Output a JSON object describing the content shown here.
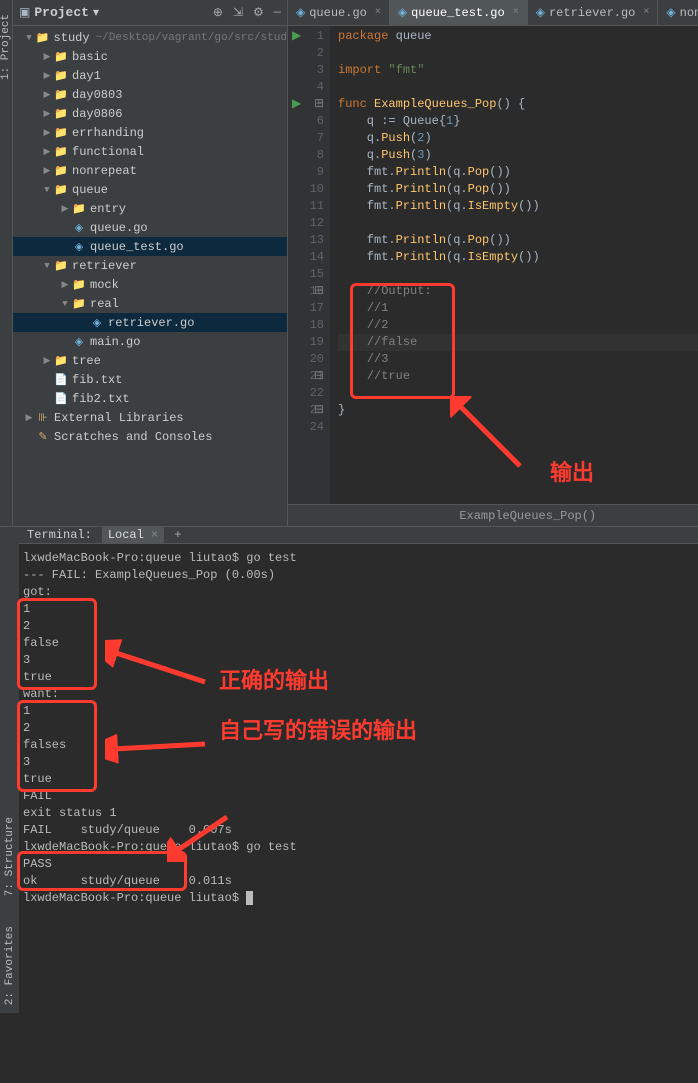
{
  "leftRail": {
    "projectLabel": "1: Project"
  },
  "sidebar": {
    "title": "Project",
    "icons": {
      "target": "⊕",
      "collapse": "⇲",
      "gear": "⚙",
      "hide": "—"
    },
    "tree": [
      {
        "lvl": 0,
        "tw": "▼",
        "ic": "📁",
        "cls": "fld",
        "nm": "study",
        "pth": "~/Desktop/vagrant/go/src/stud"
      },
      {
        "lvl": 1,
        "tw": "▶",
        "ic": "📁",
        "cls": "fld",
        "nm": "basic"
      },
      {
        "lvl": 1,
        "tw": "▶",
        "ic": "📁",
        "cls": "fld",
        "nm": "day1"
      },
      {
        "lvl": 1,
        "tw": "▶",
        "ic": "📁",
        "cls": "fld",
        "nm": "day0803"
      },
      {
        "lvl": 1,
        "tw": "▶",
        "ic": "📁",
        "cls": "fld",
        "nm": "day0806"
      },
      {
        "lvl": 1,
        "tw": "▶",
        "ic": "📁",
        "cls": "fld",
        "nm": "errhanding"
      },
      {
        "lvl": 1,
        "tw": "▶",
        "ic": "📁",
        "cls": "fld",
        "nm": "functional"
      },
      {
        "lvl": 1,
        "tw": "▶",
        "ic": "📁",
        "cls": "fld",
        "nm": "nonrepeat"
      },
      {
        "lvl": 1,
        "tw": "▼",
        "ic": "📁",
        "cls": "fld",
        "nm": "queue"
      },
      {
        "lvl": 2,
        "tw": "▶",
        "ic": "📁",
        "cls": "fld",
        "nm": "entry"
      },
      {
        "lvl": 2,
        "tw": "",
        "ic": "◈",
        "cls": "gof",
        "nm": "queue.go"
      },
      {
        "lvl": 2,
        "tw": "",
        "ic": "◈",
        "cls": "gof",
        "nm": "queue_test.go",
        "sel": true
      },
      {
        "lvl": 1,
        "tw": "▼",
        "ic": "📁",
        "cls": "fld",
        "nm": "retriever"
      },
      {
        "lvl": 2,
        "tw": "▶",
        "ic": "📁",
        "cls": "fld",
        "nm": "mock"
      },
      {
        "lvl": 2,
        "tw": "▼",
        "ic": "📁",
        "cls": "fld",
        "nm": "real"
      },
      {
        "lvl": 3,
        "tw": "",
        "ic": "◈",
        "cls": "gof",
        "nm": "retriever.go",
        "sel": true
      },
      {
        "lvl": 2,
        "tw": "",
        "ic": "◈",
        "cls": "gof",
        "nm": "main.go"
      },
      {
        "lvl": 1,
        "tw": "▶",
        "ic": "📁",
        "cls": "fld",
        "nm": "tree"
      },
      {
        "lvl": 1,
        "tw": "",
        "ic": "📄",
        "cls": "txtf",
        "nm": "fib.txt"
      },
      {
        "lvl": 1,
        "tw": "",
        "ic": "📄",
        "cls": "txtf",
        "nm": "fib2.txt"
      },
      {
        "lvl": 0,
        "tw": "▶",
        "ic": "⊪",
        "cls": "lib",
        "nm": "External Libraries"
      },
      {
        "lvl": 0,
        "tw": "",
        "ic": "✎",
        "cls": "lib",
        "nm": "Scratches and Consoles"
      }
    ]
  },
  "tabs": [
    {
      "ic": "◈",
      "nm": "queue.go"
    },
    {
      "ic": "◈",
      "nm": "queue_test.go",
      "act": true
    },
    {
      "ic": "◈",
      "nm": "retriever.go"
    },
    {
      "ic": "◈",
      "nm": "nonrepeat"
    }
  ],
  "code": {
    "lines": [
      {
        "n": 1,
        "run": true,
        "html": "<span class='kw'>package</span> <span class='id'>queue</span>"
      },
      {
        "n": 2,
        "html": ""
      },
      {
        "n": 3,
        "html": "<span class='kw'>import</span> <span class='str'>\"fmt\"</span>"
      },
      {
        "n": 4,
        "html": ""
      },
      {
        "n": 5,
        "run": true,
        "fold": "⊟",
        "html": "<span class='kw'>func</span> <span class='fn'>ExampleQueues_Pop</span>() {"
      },
      {
        "n": 6,
        "html": "    q := <span class='id'>Queue</span>{<span class='num'>1</span>}"
      },
      {
        "n": 7,
        "html": "    q.<span class='fn'>Push</span>(<span class='num'>2</span>)"
      },
      {
        "n": 8,
        "html": "    q.<span class='fn'>Push</span>(<span class='num'>3</span>)"
      },
      {
        "n": 9,
        "html": "    fmt.<span class='fn'>Println</span>(q.<span class='fn'>Pop</span>())"
      },
      {
        "n": 10,
        "html": "    fmt.<span class='fn'>Println</span>(q.<span class='fn'>Pop</span>())"
      },
      {
        "n": 11,
        "html": "    fmt.<span class='fn'>Println</span>(q.<span class='fn'>IsEmpty</span>())"
      },
      {
        "n": 12,
        "html": ""
      },
      {
        "n": 13,
        "html": "    fmt.<span class='fn'>Println</span>(q.<span class='fn'>Pop</span>())"
      },
      {
        "n": 14,
        "html": "    fmt.<span class='fn'>Println</span>(q.<span class='fn'>IsEmpty</span>())"
      },
      {
        "n": 15,
        "html": ""
      },
      {
        "n": 16,
        "fold": "⊟",
        "html": "    <span class='cm'>//Output:</span>"
      },
      {
        "n": 17,
        "html": "    <span class='cm'>//1</span>"
      },
      {
        "n": 18,
        "html": "    <span class='cm'>//2</span>"
      },
      {
        "n": 19,
        "cur": true,
        "html": "    <span class='cm'>//false</span>"
      },
      {
        "n": 20,
        "html": "    <span class='cm'>//3</span>"
      },
      {
        "n": 21,
        "fold": "⊟",
        "html": "    <span class='cm'>//true</span>"
      },
      {
        "n": 22,
        "html": ""
      },
      {
        "n": 23,
        "fold": "⊟",
        "html": "}"
      },
      {
        "n": 24,
        "html": ""
      }
    ],
    "breadcrumb": "ExampleQueues_Pop()"
  },
  "terminal": {
    "title": "Terminal:",
    "tab": "Local",
    "rails": [
      "7: Structure",
      "2: Favorites"
    ],
    "lines": [
      "lxwdeMacBook-Pro:queue liutao$ go test",
      "--- FAIL: ExampleQueues_Pop (0.00s)",
      "got:",
      "1",
      "2",
      "false",
      "3",
      "true",
      "want:",
      "1",
      "2",
      "falses",
      "3",
      "true",
      "FAIL",
      "exit status 1",
      "FAIL    study/queue    0.007s",
      "lxwdeMacBook-Pro:queue liutao$ go test",
      "PASS",
      "ok      study/queue    0.011s",
      "lxwdeMacBook-Pro:queue liutao$ "
    ]
  },
  "annos": {
    "out": "输出",
    "correct": "正确的输出",
    "wrong": "自己写的错误的输出"
  }
}
